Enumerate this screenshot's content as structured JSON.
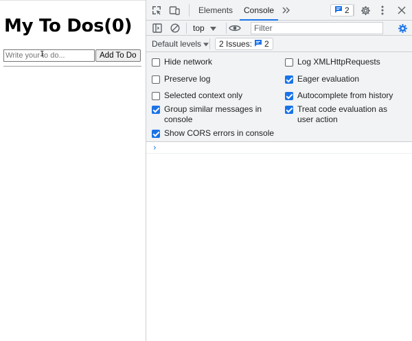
{
  "app": {
    "title": "My To Dos(0)",
    "input_placeholder": "Write your to do...",
    "add_button_label": "Add To Do"
  },
  "devtools": {
    "tabs": [
      {
        "label": "Elements",
        "active": false
      },
      {
        "label": "Console",
        "active": true
      }
    ],
    "issues_badge_count": "2",
    "context": "top",
    "filter_placeholder": "Filter",
    "levels_label": "Default levels",
    "issues_label": "2 Issues:",
    "issues_count": "2",
    "settings": {
      "left": [
        {
          "label": "Hide network",
          "checked": false
        },
        {
          "label": "Preserve log",
          "checked": false
        },
        {
          "label": "Selected context only",
          "checked": false
        },
        {
          "label": "Group similar messages in console",
          "checked": true
        },
        {
          "label": "Show CORS errors in console",
          "checked": true
        }
      ],
      "right": [
        {
          "label": "Log XMLHttpRequests",
          "checked": false
        },
        {
          "label": "Eager evaluation",
          "checked": true
        },
        {
          "label": "Autocomplete from history",
          "checked": true
        },
        {
          "label": "Treat code evaluation as user action",
          "checked": true
        }
      ]
    },
    "prompt_symbol": "›",
    "accent_color": "#1a73e8"
  }
}
